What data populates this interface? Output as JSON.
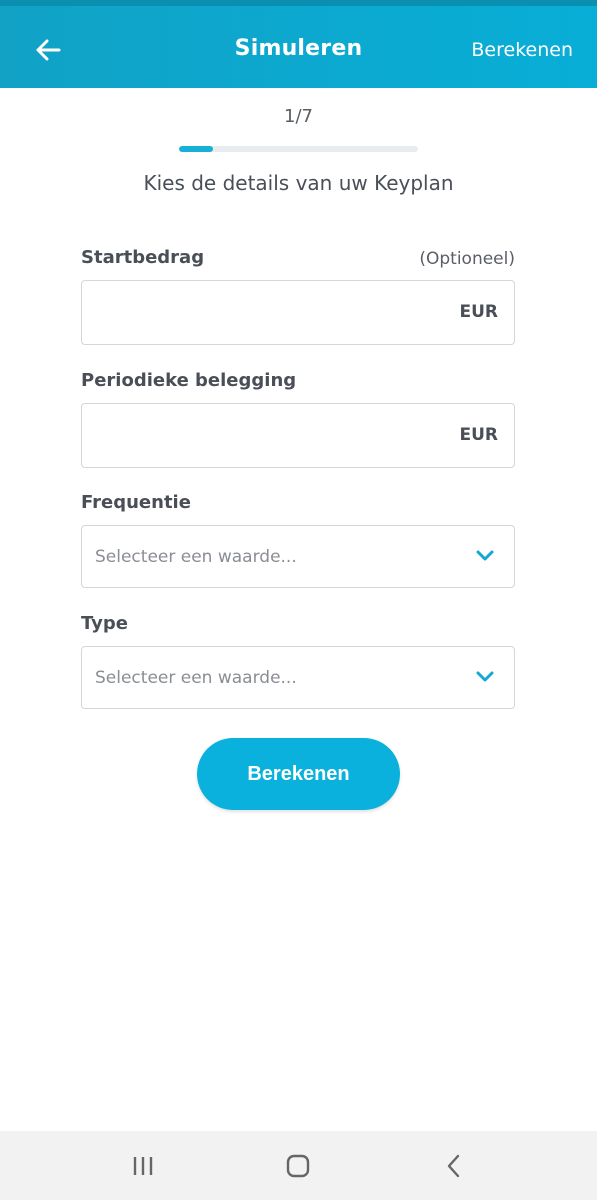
{
  "header": {
    "title": "Simuleren",
    "action_label": "Berekenen",
    "back_icon": "arrow-left-icon"
  },
  "progress": {
    "step_label": "1/7",
    "fraction": 0.143,
    "color": "#17b0d6"
  },
  "subtitle": "Kies de details van uw Keyplan",
  "form": {
    "startbedrag": {
      "label": "Startbedrag",
      "optional": "(Optioneel)",
      "value": "",
      "suffix": "EUR"
    },
    "periodiek": {
      "label": "Periodieke belegging",
      "value": "",
      "suffix": "EUR"
    },
    "frequentie": {
      "label": "Frequentie",
      "placeholder": "Selecteer een waarde...",
      "icon": "chevron-down-icon"
    },
    "type": {
      "label": "Type",
      "placeholder": "Selecteer een waarde...",
      "icon": "chevron-down-icon"
    }
  },
  "primary_button": {
    "label": "Berekenen",
    "color": "#0ab1dc"
  },
  "colors": {
    "appbar": "#08aed7",
    "accent": "#17b0d6"
  },
  "system_nav": {
    "recents_icon": "recents-icon",
    "home_icon": "home-icon",
    "back_icon": "back-chevron-icon"
  }
}
